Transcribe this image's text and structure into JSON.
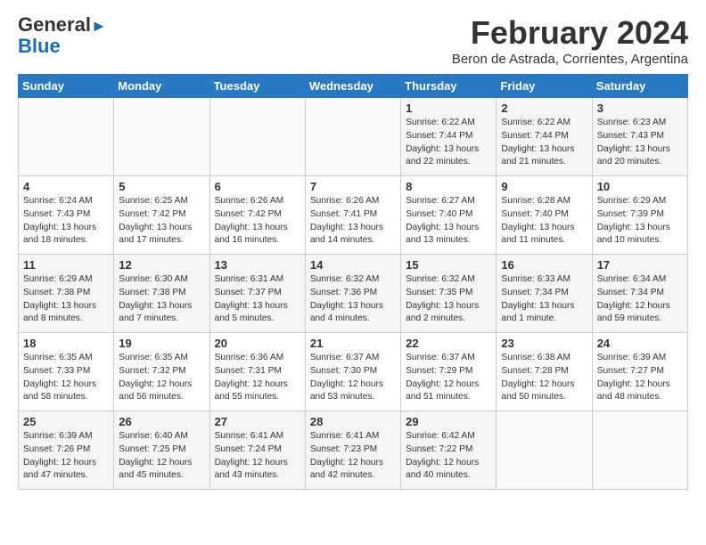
{
  "header": {
    "logo_line1": "General",
    "logo_line2": "Blue",
    "month_title": "February 2024",
    "subtitle": "Beron de Astrada, Corrientes, Argentina"
  },
  "calendar": {
    "days_of_week": [
      "Sunday",
      "Monday",
      "Tuesday",
      "Wednesday",
      "Thursday",
      "Friday",
      "Saturday"
    ],
    "weeks": [
      [
        {
          "day": "",
          "info": ""
        },
        {
          "day": "",
          "info": ""
        },
        {
          "day": "",
          "info": ""
        },
        {
          "day": "",
          "info": ""
        },
        {
          "day": "1",
          "info": "Sunrise: 6:22 AM\nSunset: 7:44 PM\nDaylight: 13 hours\nand 22 minutes."
        },
        {
          "day": "2",
          "info": "Sunrise: 6:22 AM\nSunset: 7:44 PM\nDaylight: 13 hours\nand 21 minutes."
        },
        {
          "day": "3",
          "info": "Sunrise: 6:23 AM\nSunset: 7:43 PM\nDaylight: 13 hours\nand 20 minutes."
        }
      ],
      [
        {
          "day": "4",
          "info": "Sunrise: 6:24 AM\nSunset: 7:43 PM\nDaylight: 13 hours\nand 18 minutes."
        },
        {
          "day": "5",
          "info": "Sunrise: 6:25 AM\nSunset: 7:42 PM\nDaylight: 13 hours\nand 17 minutes."
        },
        {
          "day": "6",
          "info": "Sunrise: 6:26 AM\nSunset: 7:42 PM\nDaylight: 13 hours\nand 16 minutes."
        },
        {
          "day": "7",
          "info": "Sunrise: 6:26 AM\nSunset: 7:41 PM\nDaylight: 13 hours\nand 14 minutes."
        },
        {
          "day": "8",
          "info": "Sunrise: 6:27 AM\nSunset: 7:40 PM\nDaylight: 13 hours\nand 13 minutes."
        },
        {
          "day": "9",
          "info": "Sunrise: 6:28 AM\nSunset: 7:40 PM\nDaylight: 13 hours\nand 11 minutes."
        },
        {
          "day": "10",
          "info": "Sunrise: 6:29 AM\nSunset: 7:39 PM\nDaylight: 13 hours\nand 10 minutes."
        }
      ],
      [
        {
          "day": "11",
          "info": "Sunrise: 6:29 AM\nSunset: 7:38 PM\nDaylight: 13 hours\nand 8 minutes."
        },
        {
          "day": "12",
          "info": "Sunrise: 6:30 AM\nSunset: 7:38 PM\nDaylight: 13 hours\nand 7 minutes."
        },
        {
          "day": "13",
          "info": "Sunrise: 6:31 AM\nSunset: 7:37 PM\nDaylight: 13 hours\nand 5 minutes."
        },
        {
          "day": "14",
          "info": "Sunrise: 6:32 AM\nSunset: 7:36 PM\nDaylight: 13 hours\nand 4 minutes."
        },
        {
          "day": "15",
          "info": "Sunrise: 6:32 AM\nSunset: 7:35 PM\nDaylight: 13 hours\nand 2 minutes."
        },
        {
          "day": "16",
          "info": "Sunrise: 6:33 AM\nSunset: 7:34 PM\nDaylight: 13 hours\nand 1 minute."
        },
        {
          "day": "17",
          "info": "Sunrise: 6:34 AM\nSunset: 7:34 PM\nDaylight: 12 hours\nand 59 minutes."
        }
      ],
      [
        {
          "day": "18",
          "info": "Sunrise: 6:35 AM\nSunset: 7:33 PM\nDaylight: 12 hours\nand 58 minutes."
        },
        {
          "day": "19",
          "info": "Sunrise: 6:35 AM\nSunset: 7:32 PM\nDaylight: 12 hours\nand 56 minutes."
        },
        {
          "day": "20",
          "info": "Sunrise: 6:36 AM\nSunset: 7:31 PM\nDaylight: 12 hours\nand 55 minutes."
        },
        {
          "day": "21",
          "info": "Sunrise: 6:37 AM\nSunset: 7:30 PM\nDaylight: 12 hours\nand 53 minutes."
        },
        {
          "day": "22",
          "info": "Sunrise: 6:37 AM\nSunset: 7:29 PM\nDaylight: 12 hours\nand 51 minutes."
        },
        {
          "day": "23",
          "info": "Sunrise: 6:38 AM\nSunset: 7:28 PM\nDaylight: 12 hours\nand 50 minutes."
        },
        {
          "day": "24",
          "info": "Sunrise: 6:39 AM\nSunset: 7:27 PM\nDaylight: 12 hours\nand 48 minutes."
        }
      ],
      [
        {
          "day": "25",
          "info": "Sunrise: 6:39 AM\nSunset: 7:26 PM\nDaylight: 12 hours\nand 47 minutes."
        },
        {
          "day": "26",
          "info": "Sunrise: 6:40 AM\nSunset: 7:25 PM\nDaylight: 12 hours\nand 45 minutes."
        },
        {
          "day": "27",
          "info": "Sunrise: 6:41 AM\nSunset: 7:24 PM\nDaylight: 12 hours\nand 43 minutes."
        },
        {
          "day": "28",
          "info": "Sunrise: 6:41 AM\nSunset: 7:23 PM\nDaylight: 12 hours\nand 42 minutes."
        },
        {
          "day": "29",
          "info": "Sunrise: 6:42 AM\nSunset: 7:22 PM\nDaylight: 12 hours\nand 40 minutes."
        },
        {
          "day": "",
          "info": ""
        },
        {
          "day": "",
          "info": ""
        }
      ]
    ]
  }
}
